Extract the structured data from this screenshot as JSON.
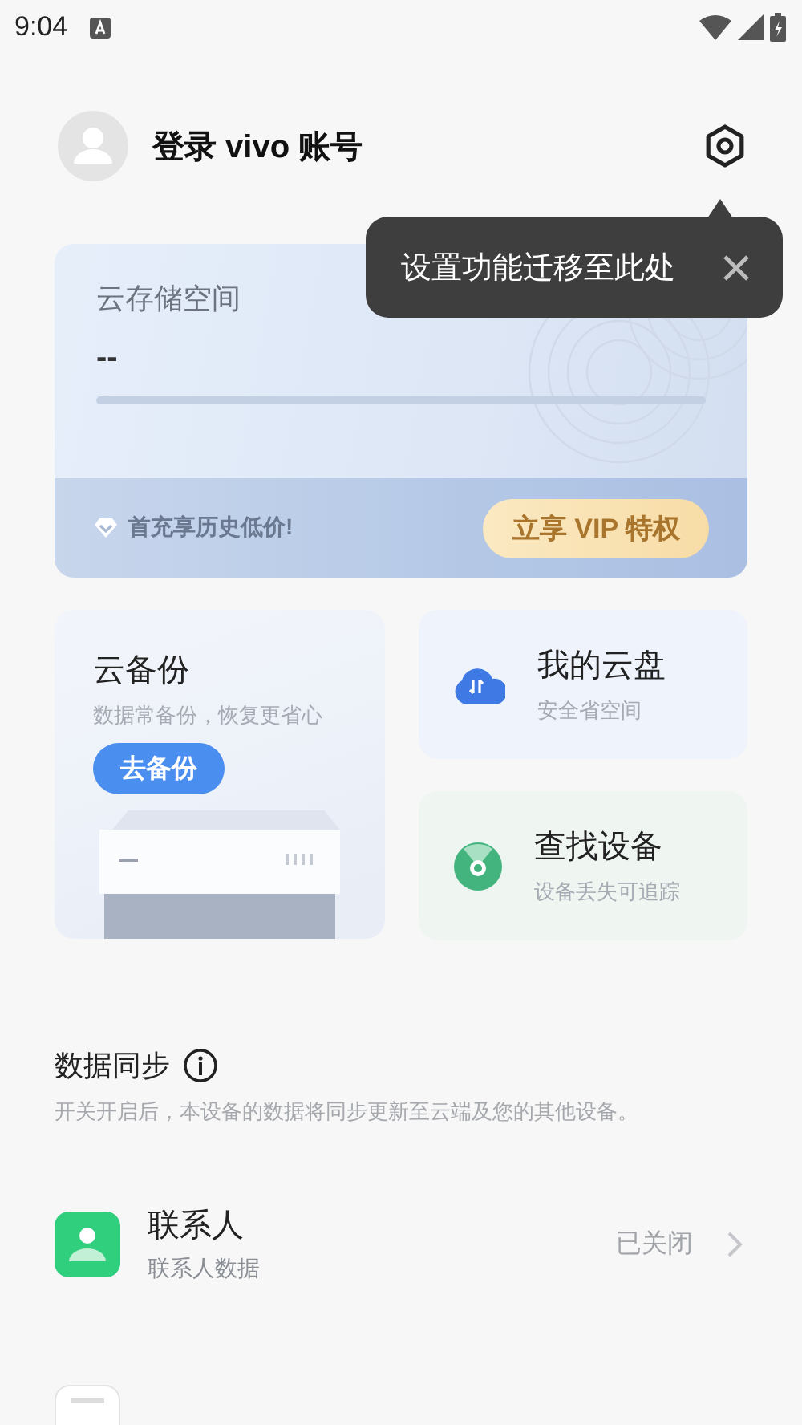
{
  "status_bar": {
    "time": "9:04"
  },
  "account": {
    "name": "登录 vivo 账号"
  },
  "tooltip": {
    "text": "设置功能迁移至此处"
  },
  "storage": {
    "title": "云存储空间",
    "usage": "--",
    "level": 0,
    "promo": "首充享历史低价!",
    "vip_button": "立享 VIP 特权"
  },
  "backup": {
    "title": "云备份",
    "subtitle": "数据常备份，恢复更省心",
    "button": "去备份"
  },
  "tiles": [
    {
      "kind": "cloud",
      "title": "我的云盘",
      "subtitle": "安全省空间"
    },
    {
      "kind": "locate",
      "title": "查找设备",
      "subtitle": "设备丢失可追踪"
    }
  ],
  "sync": {
    "title": "数据同步",
    "description": "开关开启后，本设备的数据将同步更新至云端及您的其他设备。",
    "items": [
      {
        "kind": "contacts",
        "title": "联系人",
        "subtitle": "联系人数据",
        "status": "已关闭"
      },
      {
        "kind": "calendar"
      }
    ]
  }
}
